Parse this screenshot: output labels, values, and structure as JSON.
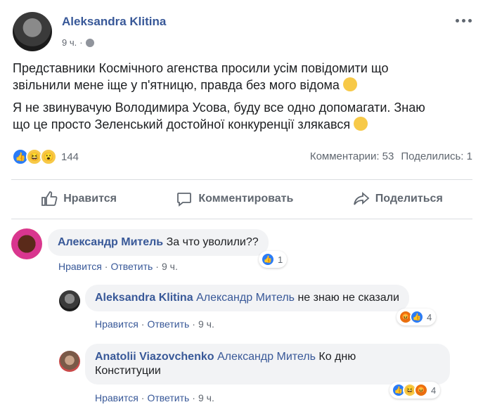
{
  "post": {
    "author": "Aleksandra Klitina",
    "time": "9 ч.",
    "text_p1_line1": "Представники Космічного агенства просили усім повідомити що",
    "text_p1_line2": "звільнили мене іще у п'ятницю, правда без мого відома",
    "text_p2_line1": "Я не звинувачую Володимира Усова, буду все одно допомагати. Знаю",
    "text_p2_line2": "що це просто Зеленський достойної конкуренції злякався",
    "reaction_count": "144",
    "comments_count": "Комментарии: 53",
    "shares_count": "Поделились: 1"
  },
  "actions": {
    "like": "Нравится",
    "comment": "Комментировать",
    "share": "Поделиться"
  },
  "comments": [
    {
      "name": "Александр Митель",
      "tag": "",
      "text": "За что уволили??",
      "like": "Нравится",
      "reply": "Ответить",
      "time": "9 ч.",
      "reactions": "1"
    },
    {
      "name": "Aleksandra Klitina",
      "tag": "Александр Митель",
      "text": "не знаю не сказали",
      "like": "Нравится",
      "reply": "Ответить",
      "time": "9 ч.",
      "reactions": "4"
    },
    {
      "name": "Anatolii Viazovchenko",
      "tag": "Александр Митель",
      "text_line1": "Ко дню",
      "text_line2": "Конституции",
      "like": "Нравится",
      "reply": "Ответить",
      "time": "9 ч.",
      "reactions": "4"
    }
  ],
  "colors": {
    "link": "#385898",
    "like_blue": "#2a7cf7",
    "bubble": "#f2f3f5"
  }
}
